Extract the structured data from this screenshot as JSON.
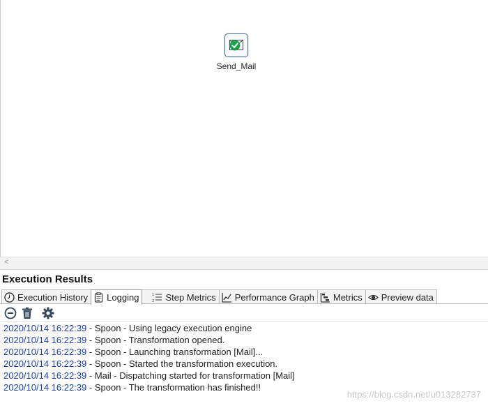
{
  "canvas": {
    "step": {
      "label": "Send_Mail",
      "icon": "mail-icon",
      "status_icon": "success-check-icon"
    },
    "scrollbar_arrow": "<"
  },
  "results": {
    "title": "Execution Results",
    "tabs": [
      {
        "label": "Execution History",
        "icon": "clock-icon"
      },
      {
        "label": "Logging",
        "icon": "clipboard-icon",
        "active": true
      },
      {
        "label": "Step Metrics",
        "icon": "list-icon"
      },
      {
        "label": "Performance Graph",
        "icon": "line-chart-icon"
      },
      {
        "label": "Metrics",
        "icon": "gantt-icon"
      },
      {
        "label": "Preview data",
        "icon": "eye-icon"
      }
    ],
    "toolbar": [
      "stop-icon",
      "trash-icon",
      "settings-icon"
    ],
    "log": [
      {
        "ts": "2020/10/14 16:22:39",
        "msg": " - Spoon - Using legacy execution engine"
      },
      {
        "ts": "2020/10/14 16:22:39",
        "msg": " - Spoon - Transformation opened."
      },
      {
        "ts": "2020/10/14 16:22:39",
        "msg": " - Spoon - Launching transformation [Mail]..."
      },
      {
        "ts": "2020/10/14 16:22:39",
        "msg": " - Spoon - Started the transformation execution."
      },
      {
        "ts": "2020/10/14 16:22:39",
        "msg": " - Mail - Dispatching started for transformation [Mail]"
      },
      {
        "ts": "2020/10/14 16:22:39",
        "msg": " - Spoon - The transformation has finished!!"
      }
    ]
  },
  "watermark": "https://blog.csdn.net/u013282737",
  "colors": {
    "timestamp": "#1a3fb4",
    "success": "#1aa34a",
    "step_border": "#4a6f92"
  }
}
